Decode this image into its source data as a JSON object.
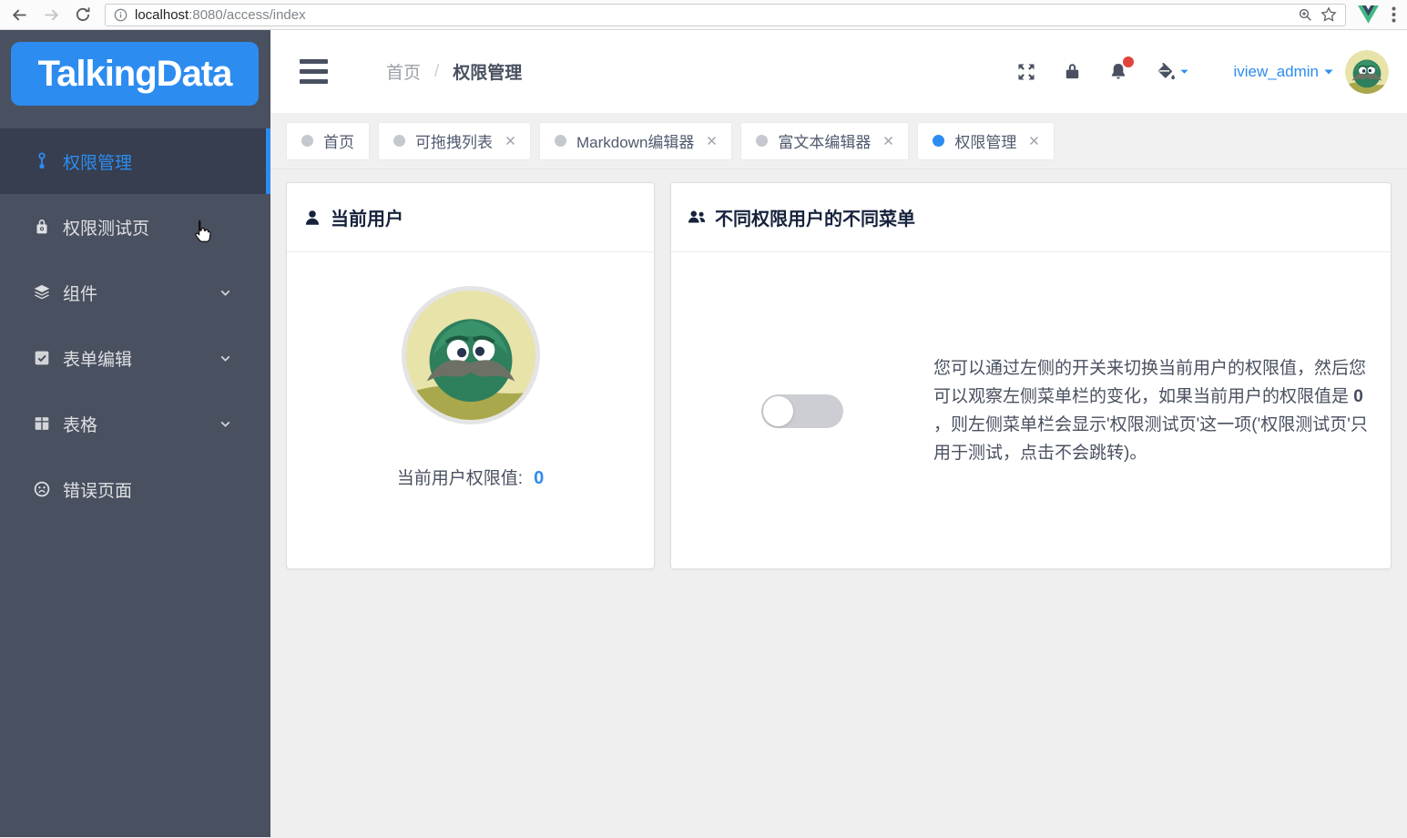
{
  "browser": {
    "url_host": "localhost",
    "url_rest": ":8080/access/index"
  },
  "sidebar": {
    "logo_text": "TalkingData",
    "items": [
      {
        "label": "权限管理",
        "icon": "key-icon",
        "active": true
      },
      {
        "label": "权限测试页",
        "icon": "lock-icon",
        "active": false
      },
      {
        "label": "组件",
        "icon": "layers-icon",
        "active": false,
        "expandable": true
      },
      {
        "label": "表单编辑",
        "icon": "checkbox-icon",
        "active": false,
        "expandable": true
      },
      {
        "label": "表格",
        "icon": "table-icon",
        "active": false,
        "expandable": true
      },
      {
        "label": "错误页面",
        "icon": "sad-face-icon",
        "active": false
      }
    ]
  },
  "header": {
    "breadcrumb_home": "首页",
    "breadcrumb_separator": "/",
    "breadcrumb_current": "权限管理",
    "icons": [
      "fullscreen-icon",
      "lock-icon",
      "bell-icon",
      "theme-icon"
    ],
    "username": "iview_admin"
  },
  "tabs": [
    {
      "label": "首页",
      "active": false,
      "closable": false
    },
    {
      "label": "可拖拽列表",
      "active": false,
      "closable": true
    },
    {
      "label": "Markdown编辑器",
      "active": false,
      "closable": true
    },
    {
      "label": "富文本编辑器",
      "active": false,
      "closable": true
    },
    {
      "label": "权限管理",
      "active": true,
      "closable": true
    }
  ],
  "cards": {
    "current_user": {
      "title": "当前用户",
      "permission_label": "当前用户权限值:",
      "permission_value": "0"
    },
    "menu_permission": {
      "title": "不同权限用户的不同菜单",
      "switch_state": "off",
      "desc_pre": "您可以通过左侧的开关来切换当前用户的权限值，然后您可以观察左侧菜单栏的变化，如果当前用户的权限值是 ",
      "desc_bold": "0",
      "desc_post": " ，则左侧菜单栏会显示'权限测试页'这一项('权限测试页'只用于测试，点击不会跳转)。"
    }
  },
  "colors": {
    "accent_blue": "#2d8cf0",
    "sidebar_bg": "#495060",
    "sidebar_active_bg": "#363e4f",
    "badge_red": "#e0453c",
    "toggle_off_gray": "#ccced3",
    "main_bg": "#efefef",
    "vue_green": "#41b883"
  }
}
